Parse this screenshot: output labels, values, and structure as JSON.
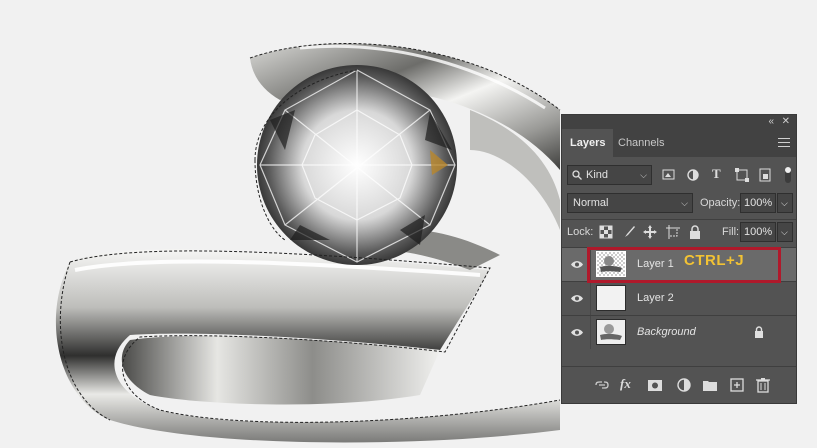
{
  "panel": {
    "collapse_glyph": "«",
    "close_glyph": "✕",
    "tabs": [
      {
        "label": "Layers",
        "active": true
      },
      {
        "label": "Channels",
        "active": false
      }
    ],
    "filter": {
      "label": "Kind"
    },
    "blend_mode": "Normal",
    "opacity_label": "Opacity:",
    "opacity_value": "100%",
    "lock_label": "Lock:",
    "fill_label": "Fill:",
    "fill_value": "100%",
    "layers": [
      {
        "name": "Layer 1",
        "selected": true,
        "visible": true
      },
      {
        "name": "Layer 2",
        "selected": false,
        "visible": true
      },
      {
        "name": "Background",
        "selected": false,
        "visible": true,
        "locked": true
      }
    ],
    "bottom_icons": [
      "link-icon",
      "fx-icon",
      "mask-icon",
      "adjustment-icon",
      "folder-icon",
      "new-layer-icon",
      "trash-icon"
    ]
  },
  "annotation": {
    "shortcut_text": "CTRL+J",
    "highlight_color": "#b0192b",
    "text_color": "#f2c234"
  },
  "colors": {
    "canvas_bg": "#f1f1f1",
    "panel_bg": "#535353",
    "panel_header": "#424242",
    "selected_row": "#6a6a6a"
  }
}
